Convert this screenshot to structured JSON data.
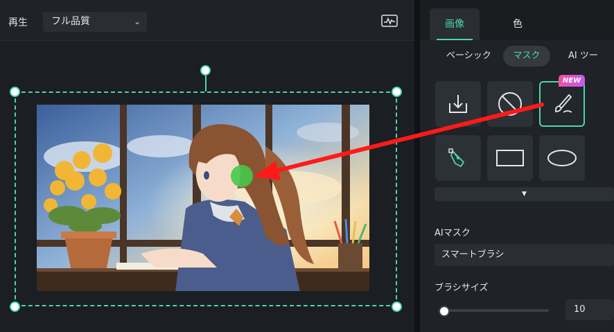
{
  "toolbar": {
    "play_label": "再生",
    "quality_value": "フル品質"
  },
  "tabs": {
    "image": "画像",
    "color": "色"
  },
  "subtabs": {
    "basic": "ベーシック",
    "mask": "マスク",
    "ai_tools": "AI ツー"
  },
  "mask_tools": {
    "new_badge": "NEW",
    "icons": [
      "import-mask-icon",
      "circle-slash-icon",
      "ai-brush-icon",
      "pen-tool-icon",
      "rectangle-icon",
      "ellipse-icon"
    ]
  },
  "ai_mask": {
    "section_label": "AIマスク",
    "mode_value": "スマートブラシ",
    "brush_size_label": "ブラシサイズ",
    "brush_size_value": "10",
    "brush_size_fraction": 0.02
  },
  "colors": {
    "accent": "#4dd5b0",
    "arrow": "#ff1a1a",
    "brush_dot": "#46c84a"
  }
}
